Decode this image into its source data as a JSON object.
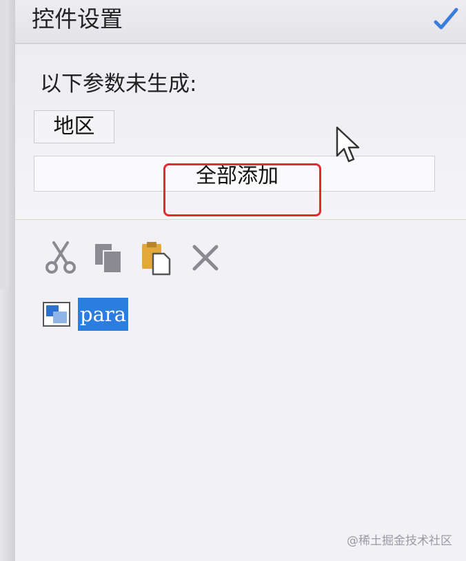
{
  "header": {
    "title": "控件设置",
    "confirm_icon": "checkmark-icon",
    "accent_color": "#3b7dd8"
  },
  "params": {
    "hint": "以下参数未生成:",
    "items": [
      "地区"
    ],
    "add_all_label": "全部添加"
  },
  "annotation": {
    "highlight_color": "#e8262b"
  },
  "toolbar": {
    "tools": [
      {
        "name": "cut",
        "icon": "scissors-icon"
      },
      {
        "name": "copy",
        "icon": "copy-icon"
      },
      {
        "name": "paste",
        "icon": "paste-icon"
      },
      {
        "name": "delete",
        "icon": "close-icon"
      }
    ]
  },
  "tree": {
    "items": [
      {
        "label": "para",
        "icon": "widget-icon",
        "selected": true
      }
    ],
    "selection_color": "#2b7de0"
  },
  "watermark": "@稀土掘金技术社区"
}
